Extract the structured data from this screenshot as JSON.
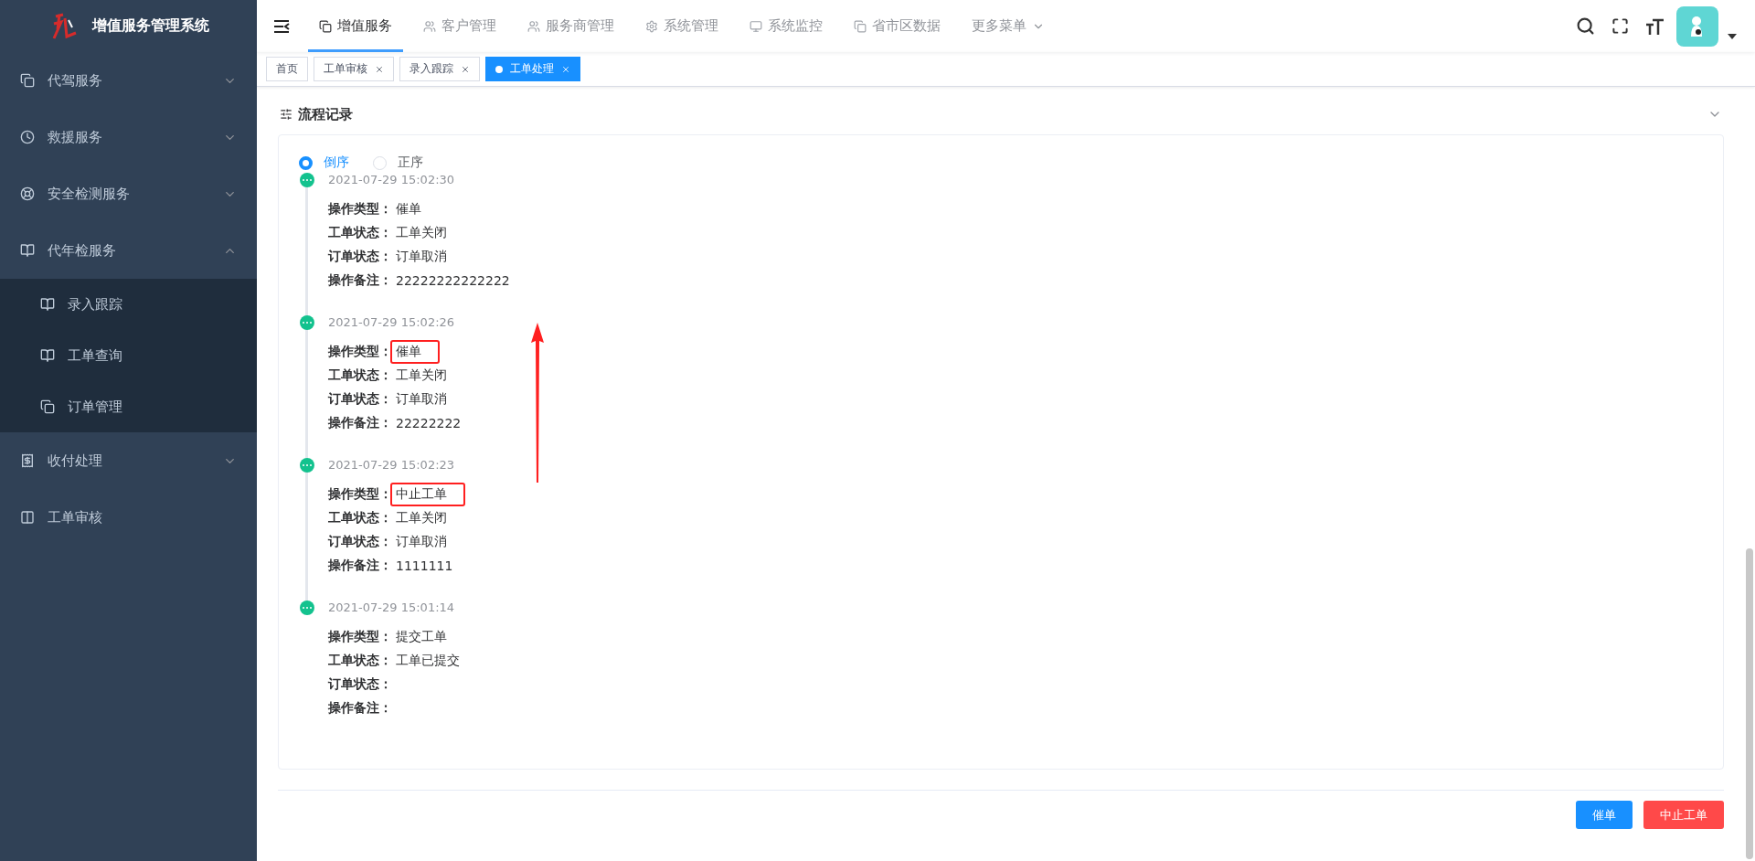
{
  "app": {
    "title": "增值服务管理系统"
  },
  "sidebar": {
    "items": [
      {
        "label": "代驾服务",
        "kind": "group",
        "expanded": false
      },
      {
        "label": "救援服务",
        "kind": "group",
        "expanded": false
      },
      {
        "label": "安全检测服务",
        "kind": "group",
        "expanded": false
      },
      {
        "label": "代年检服务",
        "kind": "group",
        "expanded": true,
        "children": [
          {
            "label": "录入跟踪"
          },
          {
            "label": "工单查询"
          },
          {
            "label": "订单管理"
          }
        ]
      },
      {
        "label": "收付处理",
        "kind": "group",
        "expanded": false
      },
      {
        "label": "工单审核",
        "kind": "link"
      }
    ]
  },
  "top_nav": {
    "tabs": [
      {
        "label": "增值服务",
        "selected": true,
        "kind": "tab"
      },
      {
        "label": "客户管理",
        "selected": false,
        "kind": "tab"
      },
      {
        "label": "服务商管理",
        "selected": false,
        "kind": "tab"
      },
      {
        "label": "系统管理",
        "selected": false,
        "kind": "tab"
      },
      {
        "label": "系统监控",
        "selected": false,
        "kind": "tab"
      },
      {
        "label": "省市区数据",
        "selected": false,
        "kind": "tab"
      },
      {
        "label": "更多菜单",
        "selected": false,
        "kind": "dropdown"
      }
    ]
  },
  "tags": [
    {
      "label": "首页",
      "selected": false,
      "closable": false
    },
    {
      "label": "工单审核",
      "selected": false,
      "closable": true
    },
    {
      "label": "录入跟踪",
      "selected": false,
      "closable": true
    },
    {
      "label": "工单处理",
      "selected": true,
      "closable": true
    }
  ],
  "section": {
    "title": "流程记录",
    "expanded": true
  },
  "sort": {
    "options": [
      {
        "label": "倒序",
        "selected": true
      },
      {
        "label": "正序",
        "selected": false
      }
    ]
  },
  "records": [
    {
      "time": "2021-07-29 15:02:30",
      "fields": [
        {
          "label": "操作类型：",
          "value": "催单"
        },
        {
          "label": "工单状态：",
          "value": "工单关闭"
        },
        {
          "label": "订单状态：",
          "value": "订单取消"
        },
        {
          "label": "操作备注：",
          "value": "22222222222222"
        }
      ]
    },
    {
      "time": "2021-07-29 15:02:26",
      "fields": [
        {
          "label": "操作类型：",
          "value": "催单",
          "highlighted": true
        },
        {
          "label": "工单状态：",
          "value": "工单关闭"
        },
        {
          "label": "订单状态：",
          "value": "订单取消"
        },
        {
          "label": "操作备注：",
          "value": "22222222"
        }
      ]
    },
    {
      "time": "2021-07-29 15:02:23",
      "fields": [
        {
          "label": "操作类型：",
          "value": "中止工单",
          "highlighted": true
        },
        {
          "label": "工单状态：",
          "value": "工单关闭"
        },
        {
          "label": "订单状态：",
          "value": "订单取消"
        },
        {
          "label": "操作备注：",
          "value": "1111111"
        }
      ]
    },
    {
      "time": "2021-07-29 15:01:14",
      "fields": [
        {
          "label": "操作类型：",
          "value": "提交工单"
        },
        {
          "label": "工单状态：",
          "value": "工单已提交"
        },
        {
          "label": "订单状态："
        },
        {
          "label": "操作备注："
        }
      ]
    }
  ],
  "actions": [
    {
      "label": "催单",
      "kind": "primary"
    },
    {
      "label": "中止工单",
      "kind": "danger"
    }
  ]
}
